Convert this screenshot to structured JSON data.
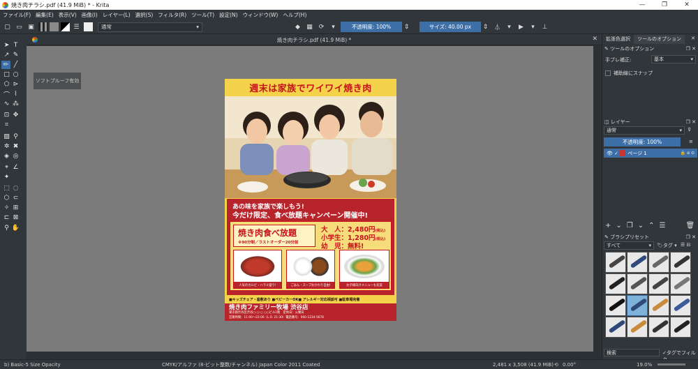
{
  "window": {
    "title": "焼き肉チラシ.pdf (41.9 MiB) * - Krita",
    "minimize": "—",
    "maximize": "❐",
    "close": "✕"
  },
  "menu": [
    "ファイル(F)",
    "編集(E)",
    "表示(V)",
    "画像(I)",
    "レイヤー(L)",
    "選択(S)",
    "フィルタ(R)",
    "ツール(T)",
    "設定(N)",
    "ウィンドウ(W)",
    "ヘルプ(H)"
  ],
  "toolbar": {
    "blend_mode": "通常",
    "opacity": "不透明度: 100%",
    "size": "サイズ: 40.00 px"
  },
  "document": {
    "tab_title": "焼き肉チラシ.pdf (41.9 MiB) *",
    "softproof_label": "ソフトプルーフ有効"
  },
  "poster": {
    "title": "週末は家族でワイワイ焼き肉",
    "headline1": "あの味を家族で楽しもう!",
    "headline2": "今だけ限定、食べ放題キャンペーン開催中!",
    "plan_name": "焼き肉食べ放題",
    "plan_note": "※90分制／ラストオーダー20分前",
    "prices": [
      {
        "label": "大　人：2,480円",
        "tax": "(税込)"
      },
      {
        "label": "小学生：1,280円",
        "tax": "(税込)"
      },
      {
        "label": "幼　児：無料!",
        "tax": ""
      }
    ],
    "food_captions": [
      "人気のカルビ・ハラミ盛り!",
      "ごはん・スープおかわり自由!",
      "お子様向けメニューも充実"
    ],
    "features": "■キッズチェア・座敷あり ■ベビーカーOK■ アレルギー対応相談可 ■駐車場完備",
    "store_name": "焼き肉ファミリー牧場 渋谷店",
    "address": "東京都渋谷区渋谷○-○-○ ○○ビル1階　定休日：火曜日",
    "hours": "営業時間：11:00～22:00（L.O. 21:30）電話番号：000-1234-5678"
  },
  "right_dock": {
    "tabs": [
      "拡張色選択",
      "ツールのオプション"
    ],
    "tool_options_title": "ツールのオプション",
    "smoothing_label": "手ブレ補正:",
    "smoothing_value": "基本",
    "snap_label": "補助線にスナップ",
    "layers_title": "レイヤー",
    "layer_blend": "通常",
    "layer_opacity": "不透明度: 100%",
    "layer_name": "ページ 1",
    "brush_presets_title": "ブラシプリセット",
    "preset_filter": "すべて",
    "tag_label": "タグ",
    "search_placeholder": "検索",
    "filter_tag_label": "タグでフィルタ"
  },
  "status": {
    "brush": "b) Basic-5 Size Opacity",
    "color_profile": "CMYK/アルファ (8-ビット整数/チャンネル)  Japan Color 2011 Coated",
    "dimensions": "2,481 x 3,508 (41.9 MiB)",
    "rotation": "0.00°",
    "zoom": "19.0%"
  },
  "colors": {
    "accent": "#3d6ea5",
    "poster_red": "#b8242c",
    "poster_yellow": "#f4d24a"
  }
}
